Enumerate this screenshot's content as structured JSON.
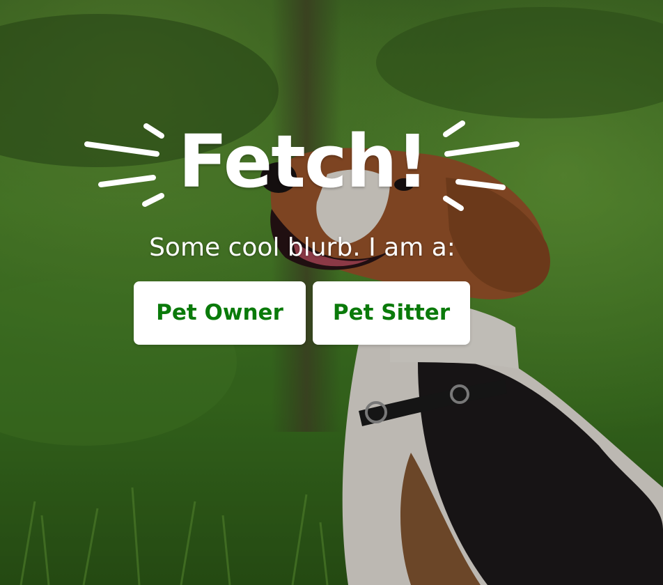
{
  "brand": {
    "logo_text": "Fetch!"
  },
  "hero": {
    "blurb": "Some cool blurb. I am a:"
  },
  "actions": {
    "pet_owner_label": "Pet Owner",
    "pet_sitter_label": "Pet Sitter"
  },
  "colors": {
    "button_text": "#0a7a0a",
    "button_bg": "#ffffff",
    "text": "#ffffff"
  }
}
